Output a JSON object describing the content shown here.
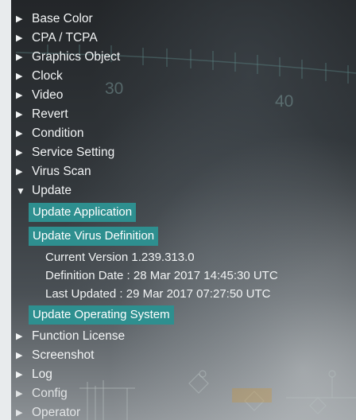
{
  "background": {
    "hud_labels": [
      "30",
      "40"
    ],
    "accent": "#2e8f8f"
  },
  "menu": {
    "items_top": [
      {
        "label": "Base Color"
      },
      {
        "label": "CPA / TCPA"
      },
      {
        "label": "Graphics Object"
      },
      {
        "label": "Clock"
      },
      {
        "label": "Video"
      },
      {
        "label": "Revert"
      },
      {
        "label": "Condition"
      },
      {
        "label": "Service Setting"
      },
      {
        "label": "Virus Scan"
      }
    ],
    "expanded": {
      "label": "Update",
      "actions": {
        "app": "Update Application",
        "virus": "Update Virus Definition",
        "os": "Update Operating System"
      },
      "details": {
        "version": "Current Version 1.239.313.0",
        "def_date": "Definition Date : 28 Mar 2017 14:45:30 UTC",
        "last_updated": "Last Updated : 29 Mar 2017 07:27:50 UTC"
      }
    },
    "items_bottom": [
      {
        "label": "Function License"
      },
      {
        "label": "Screenshot"
      },
      {
        "label": "Log"
      },
      {
        "label": "Config"
      },
      {
        "label": "Operator"
      }
    ]
  }
}
